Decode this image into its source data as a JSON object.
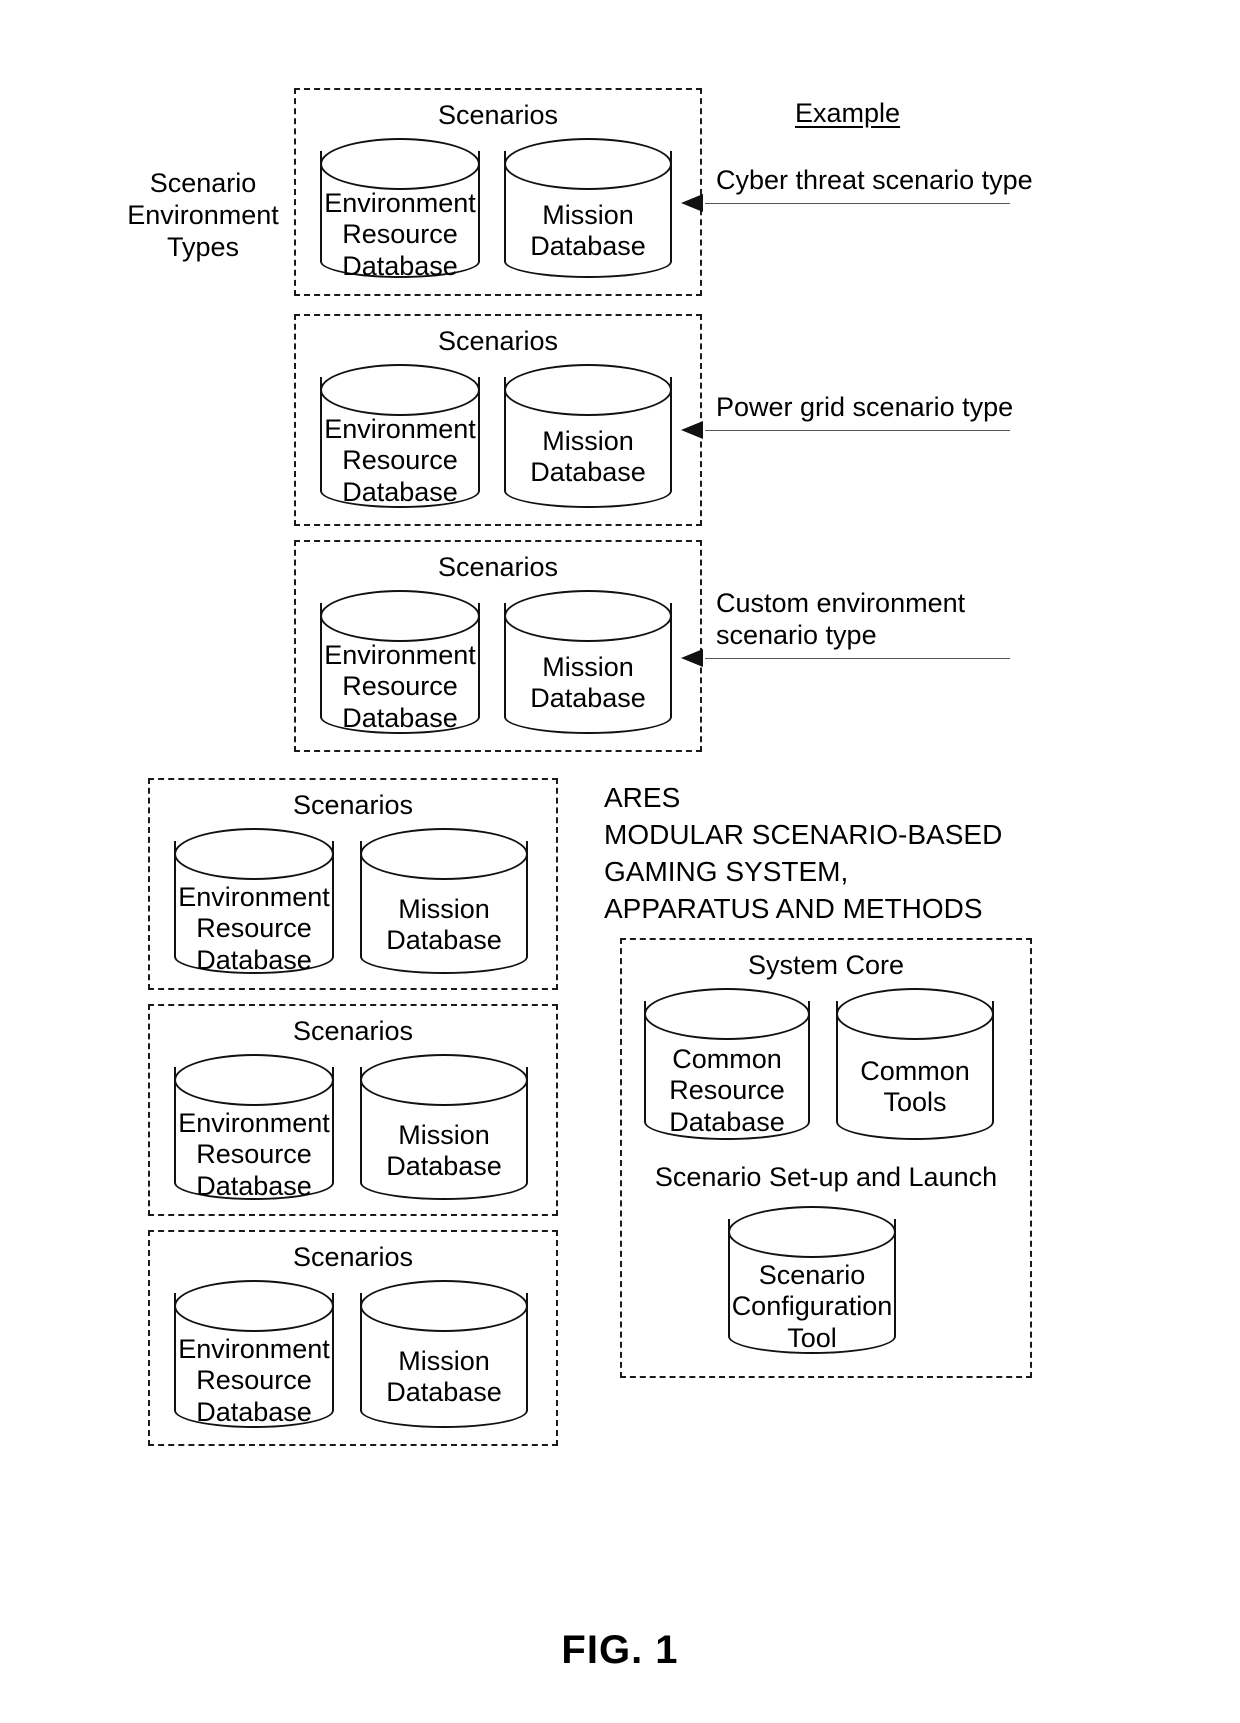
{
  "figure": {
    "caption": "FIG. 1",
    "example_heading": "Example",
    "left_group_label": "Scenario\nEnvironment\nTypes",
    "system_title": "ARES\nMODULAR SCENARIO-BASED\nGAMING SYSTEM,\nAPPARATUS AND METHODS"
  },
  "common": {
    "scenarios_title": "Scenarios",
    "environment_db": "Environment\nResource\nDatabase",
    "mission_db": "Mission\nDatabase"
  },
  "scenario_types": [
    {
      "title": "Scenarios",
      "databases": [
        {
          "name": "environment-resource-database",
          "label": "Environment\nResource\nDatabase"
        },
        {
          "name": "mission-database",
          "label": "Mission\nDatabase"
        }
      ],
      "callout": "Cyber threat scenario type"
    },
    {
      "title": "Scenarios",
      "databases": [
        {
          "name": "environment-resource-database",
          "label": "Environment\nResource\nDatabase"
        },
        {
          "name": "mission-database",
          "label": "Mission\nDatabase"
        }
      ],
      "callout": "Power grid scenario type"
    },
    {
      "title": "Scenarios",
      "databases": [
        {
          "name": "environment-resource-database",
          "label": "Environment\nResource\nDatabase"
        },
        {
          "name": "mission-database",
          "label": "Mission\nDatabase"
        }
      ],
      "callout": "Custom environment\nscenario type"
    }
  ],
  "scenario_instances": [
    {
      "title": "Scenarios",
      "databases": [
        {
          "name": "environment-resource-database",
          "label": "Environment\nResource\nDatabase"
        },
        {
          "name": "mission-database",
          "label": "Mission\nDatabase"
        }
      ]
    },
    {
      "title": "Scenarios",
      "databases": [
        {
          "name": "environment-resource-database",
          "label": "Environment\nResource\nDatabase"
        },
        {
          "name": "mission-database",
          "label": "Mission\nDatabase"
        }
      ]
    },
    {
      "title": "Scenarios",
      "databases": [
        {
          "name": "environment-resource-database",
          "label": "Environment\nResource\nDatabase"
        },
        {
          "name": "mission-database",
          "label": "Mission\nDatabase"
        }
      ]
    }
  ],
  "system_core": {
    "title": "System Core",
    "common_resource_database": "Common\nResource\nDatabase",
    "common_tools": "Common\nTools",
    "setup_section_title": "Scenario Set-up and Launch",
    "scenario_configuration_tool": "Scenario\nConfiguration\nTool"
  },
  "colors": {
    "ink": "#000000",
    "line": "#111111",
    "leader": "#555555",
    "paper": "#ffffff"
  }
}
